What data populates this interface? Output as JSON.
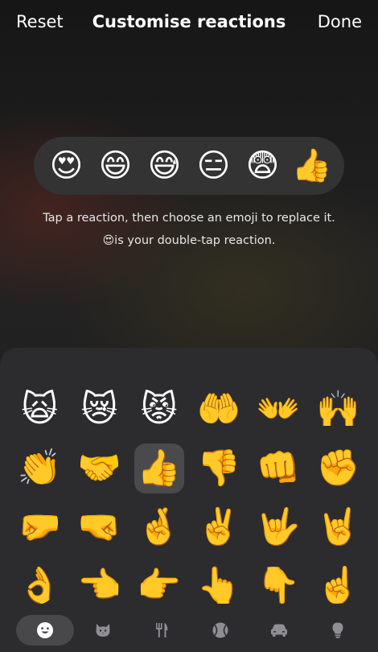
{
  "header": {
    "reset_label": "Reset",
    "title": "Customise reactions",
    "done_label": "Done"
  },
  "reactions": [
    {
      "emoji": "😍",
      "name": "heart-eyes"
    },
    {
      "emoji": "😄",
      "name": "grinning"
    },
    {
      "emoji": "😅",
      "name": "grinning-sweat"
    },
    {
      "emoji": "😑",
      "name": "expressionless"
    },
    {
      "emoji": "😨",
      "name": "fearful"
    },
    {
      "emoji": "👍",
      "name": "thumbs-up"
    }
  ],
  "hint": {
    "line1": "Tap a reaction, then choose an emoji to replace it.",
    "line2_emoji": "😍",
    "line2_text": "is your double-tap reaction."
  },
  "emoji_grid": [
    "🙀",
    "😿",
    "😾",
    "🤲",
    "👐",
    "🙌",
    "👏",
    "🤝",
    "👍",
    "👎",
    "👊",
    "✊",
    "🤛",
    "🤜",
    "🤞",
    "✌️",
    "🤟",
    "🤘",
    "👌",
    "👈",
    "👉",
    "👆",
    "👇",
    "☝️"
  ],
  "selected_index": 8,
  "categories": [
    {
      "icon": "smiley-icon",
      "active": true
    },
    {
      "icon": "cat-icon",
      "active": false
    },
    {
      "icon": "fork-knife-icon",
      "active": false
    },
    {
      "icon": "ball-icon",
      "active": false
    },
    {
      "icon": "car-icon",
      "active": false
    },
    {
      "icon": "lightbulb-icon",
      "active": false
    }
  ]
}
